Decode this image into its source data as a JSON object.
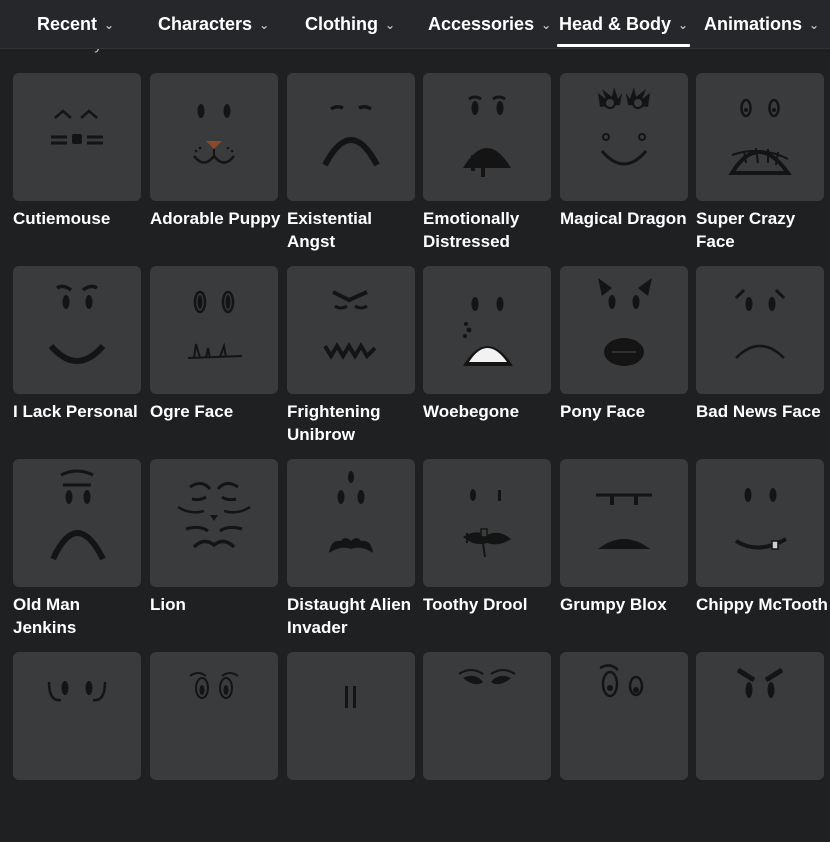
{
  "nav": {
    "tabs": [
      {
        "label": "Recent",
        "icon": "chevron-down-icon"
      },
      {
        "label": "Characters",
        "icon": "chevron-down-icon"
      },
      {
        "label": "Clothing",
        "icon": "chevron-down-icon"
      },
      {
        "label": "Accessories",
        "icon": "chevron-down-icon"
      },
      {
        "label": "Head & Body",
        "icon": "chevron-down-icon",
        "active": true
      },
      {
        "label": "Animations",
        "icon": "chevron-down-icon"
      }
    ],
    "chevron": "⌄"
  },
  "breadcrumb": {
    "text": "Head & Body > Classic Faces"
  },
  "items": [
    {
      "name": "Cutiemouse",
      "icon": "cutiemouse-face-icon"
    },
    {
      "name": "Adorable Puppy",
      "icon": "adorable-puppy-face-icon"
    },
    {
      "name": "Existential Angst",
      "icon": "existential-angst-face-icon"
    },
    {
      "name": "Emotionally Distressed",
      "icon": "emotionally-distressed-face-icon"
    },
    {
      "name": "Magical Dragon",
      "icon": "magical-dragon-face-icon"
    },
    {
      "name": "Super Crazy Face",
      "icon": "super-crazy-face-icon"
    },
    {
      "name": "I Lack Personal",
      "icon": "i-lack-personal-face-icon"
    },
    {
      "name": "Ogre Face",
      "icon": "ogre-face-icon"
    },
    {
      "name": "Frightening Unibrow",
      "icon": "frightening-unibrow-face-icon"
    },
    {
      "name": "Woebegone",
      "icon": "woebegone-face-icon"
    },
    {
      "name": "Pony Face",
      "icon": "pony-face-icon"
    },
    {
      "name": "Bad News Face",
      "icon": "bad-news-face-icon"
    },
    {
      "name": "Old Man Jenkins",
      "icon": "old-man-jenkins-face-icon"
    },
    {
      "name": "Lion",
      "icon": "lion-face-icon"
    },
    {
      "name": "Distaught Alien Invader",
      "icon": "distaught-alien-invader-face-icon"
    },
    {
      "name": "Toothy Drool",
      "icon": "toothy-drool-face-icon"
    },
    {
      "name": "Grumpy Blox",
      "icon": "grumpy-blox-face-icon"
    },
    {
      "name": "Chippy McTooth",
      "icon": "chippy-mctooth-face-icon"
    },
    {
      "name": "",
      "icon": "round-eyes-face-icon"
    },
    {
      "name": "",
      "icon": "outlined-eyes-face-icon"
    },
    {
      "name": "",
      "icon": "straight-lines-face-icon"
    },
    {
      "name": "",
      "icon": "squint-eyes-face-icon"
    },
    {
      "name": "",
      "icon": "goofy-eyes-face-icon"
    },
    {
      "name": "",
      "icon": "angry-brows-face-icon"
    }
  ]
}
